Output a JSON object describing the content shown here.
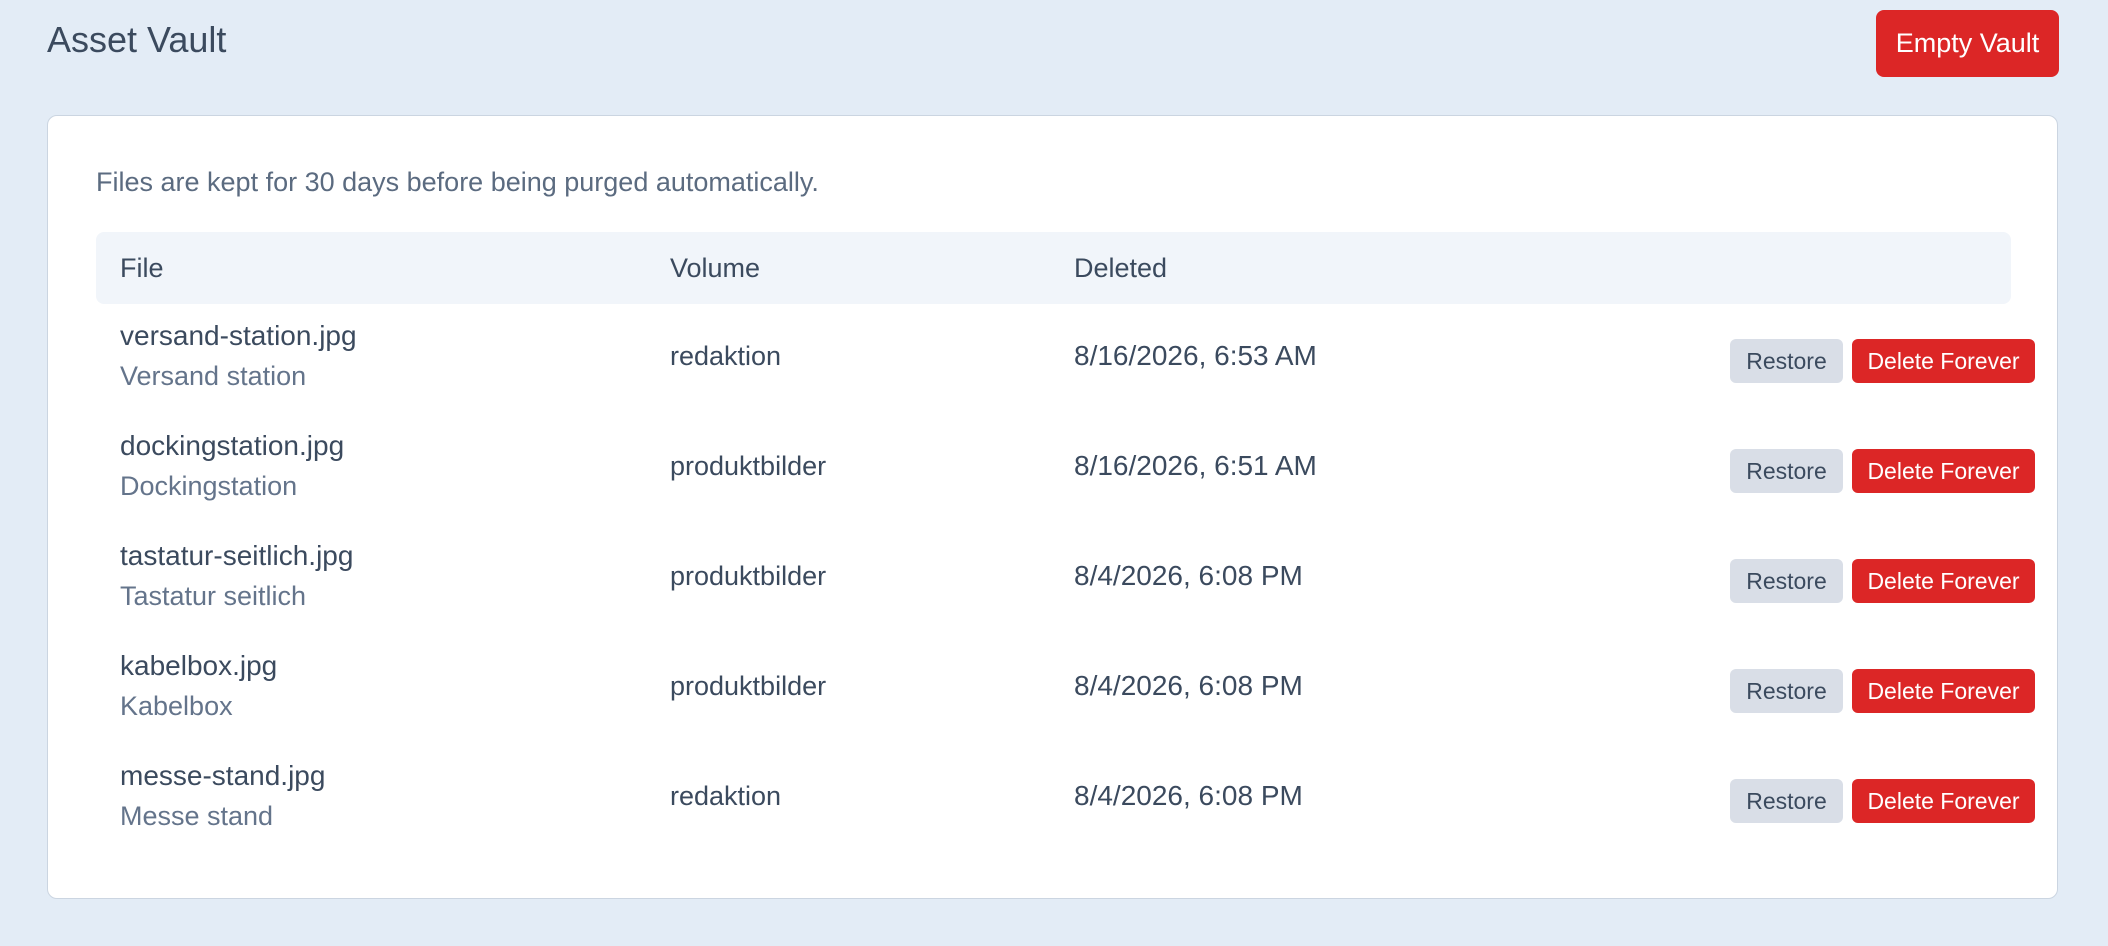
{
  "header": {
    "title": "Asset Vault",
    "empty_button_label": "Empty Vault"
  },
  "card": {
    "note": "Files are kept for 30 days before being purged automatically.",
    "columns": {
      "file": "File",
      "volume": "Volume",
      "deleted": "Deleted"
    },
    "rows": [
      {
        "filename": "versand-station.jpg",
        "title": "Versand station",
        "volume": "redaktion",
        "deleted": "8/16/2026, 6:53 AM",
        "restore_label": "Restore",
        "delete_label": "Delete Forever"
      },
      {
        "filename": "dockingstation.jpg",
        "title": "Dockingstation",
        "volume": "produktbilder",
        "deleted": "8/16/2026, 6:51 AM",
        "restore_label": "Restore",
        "delete_label": "Delete Forever"
      },
      {
        "filename": "tastatur-seitlich.jpg",
        "title": "Tastatur seitlich",
        "volume": "produktbilder",
        "deleted": "8/4/2026, 6:08 PM",
        "restore_label": "Restore",
        "delete_label": "Delete Forever"
      },
      {
        "filename": "kabelbox.jpg",
        "title": "Kabelbox",
        "volume": "produktbilder",
        "deleted": "8/4/2026, 6:08 PM",
        "restore_label": "Restore",
        "delete_label": "Delete Forever"
      },
      {
        "filename": "messe-stand.jpg",
        "title": "Messe stand",
        "volume": "redaktion",
        "deleted": "8/4/2026, 6:08 PM",
        "restore_label": "Restore",
        "delete_label": "Delete Forever"
      }
    ]
  },
  "colors": {
    "background": "#e3ecf6",
    "danger": "#dc2626",
    "secondary_button": "#d9dee7",
    "header_row": "#f1f5fa"
  }
}
